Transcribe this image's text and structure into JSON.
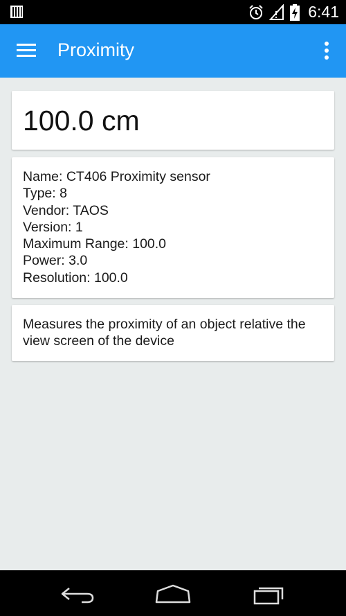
{
  "status_bar": {
    "time": "6:41",
    "icons": [
      "sim-card-icon",
      "alarm-icon",
      "signal-icon",
      "battery-charging-icon"
    ]
  },
  "app_bar": {
    "title": "Proximity",
    "color": "#2196f3",
    "icons": [
      "menu-icon",
      "overflow-menu-icon"
    ]
  },
  "reading": {
    "value": "100.0 cm"
  },
  "sensor_info": {
    "lines": [
      "Name: CT406 Proximity sensor",
      "Type: 8",
      "Vendor: TAOS",
      "Version: 1",
      "Maximum Range: 100.0",
      "Power: 3.0",
      "Resolution: 100.0"
    ]
  },
  "description": {
    "text": "Measures the proximity of an object relative the view screen of the device"
  },
  "nav_bar": {
    "buttons": [
      "back-icon",
      "home-icon",
      "recents-icon"
    ]
  }
}
